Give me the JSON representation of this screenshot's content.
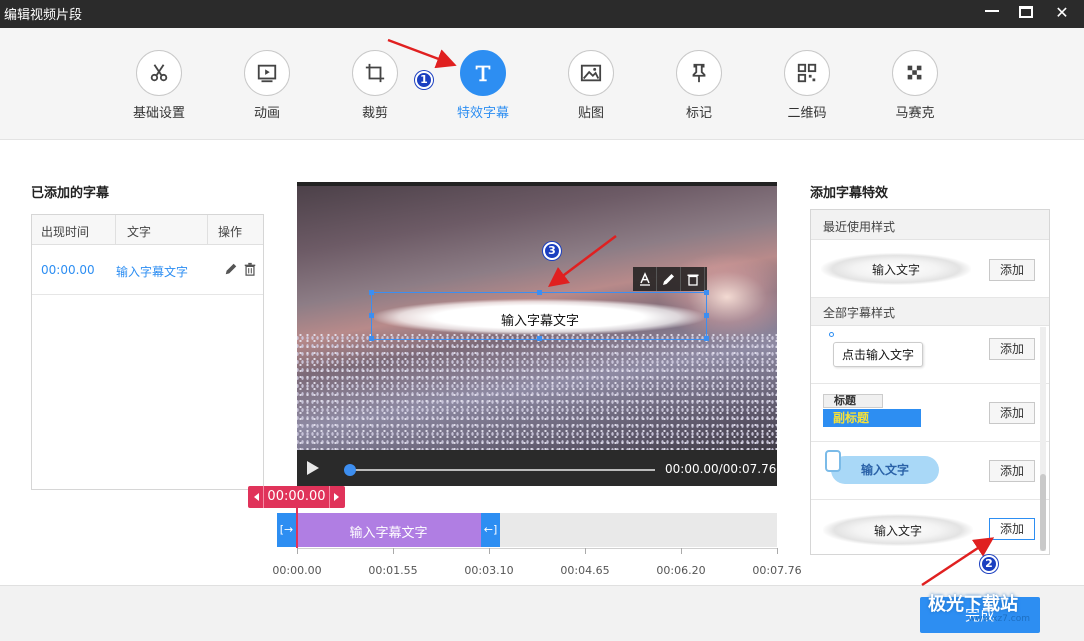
{
  "window": {
    "title": "编辑视频片段"
  },
  "toolbar": {
    "items": [
      {
        "label": "基础设置",
        "icon": "scissors-icon"
      },
      {
        "label": "动画",
        "icon": "play-frame-icon"
      },
      {
        "label": "裁剪",
        "icon": "crop-icon"
      },
      {
        "label": "特效字幕",
        "icon": "text-t-icon",
        "active": true
      },
      {
        "label": "贴图",
        "icon": "image-icon"
      },
      {
        "label": "标记",
        "icon": "pin-icon"
      },
      {
        "label": "二维码",
        "icon": "qrcode-icon"
      },
      {
        "label": "马赛克",
        "icon": "mosaic-icon"
      }
    ]
  },
  "left_panel": {
    "title": "已添加的字幕",
    "columns": [
      "出现时间",
      "文字",
      "操作"
    ],
    "rows": [
      {
        "time": "00:00.00",
        "text": "输入字幕文字"
      }
    ]
  },
  "preview": {
    "subtitle_text": "输入字幕文字",
    "timecode": "00:00.00/00:07.76"
  },
  "timeline": {
    "current_time": "00:00.00",
    "clip_label": "输入字幕文字",
    "ticks": [
      "00:00.00",
      "00:01.55",
      "00:03.10",
      "00:04.65",
      "00:06.20",
      "00:07.76"
    ]
  },
  "right_panel": {
    "title": "添加字幕特效",
    "recent_header": "最近使用样式",
    "all_header": "全部字幕样式",
    "recent_styles": [
      {
        "preview_text": "输入文字",
        "add_label": "添加"
      }
    ],
    "all_styles": [
      {
        "preview_text": "点击输入文字",
        "add_label": "添加"
      },
      {
        "preview_title": "标题",
        "preview_subtitle": "副标题",
        "add_label": "添加"
      },
      {
        "preview_text": "输入文字",
        "add_label": "添加"
      },
      {
        "preview_text": "输入文字",
        "add_label": "添加"
      }
    ]
  },
  "footer": {
    "done_label": "完成",
    "watermark": "极光下载站",
    "watermark_sub": "www.xz7.com"
  },
  "annotations": {
    "badge1": "1",
    "badge2": "2",
    "badge3": "3"
  },
  "colors": {
    "accent": "#2d8ef2",
    "playhead": "#e0335a",
    "clip": "#b07ee3",
    "annotation_arrow": "#e02020"
  }
}
